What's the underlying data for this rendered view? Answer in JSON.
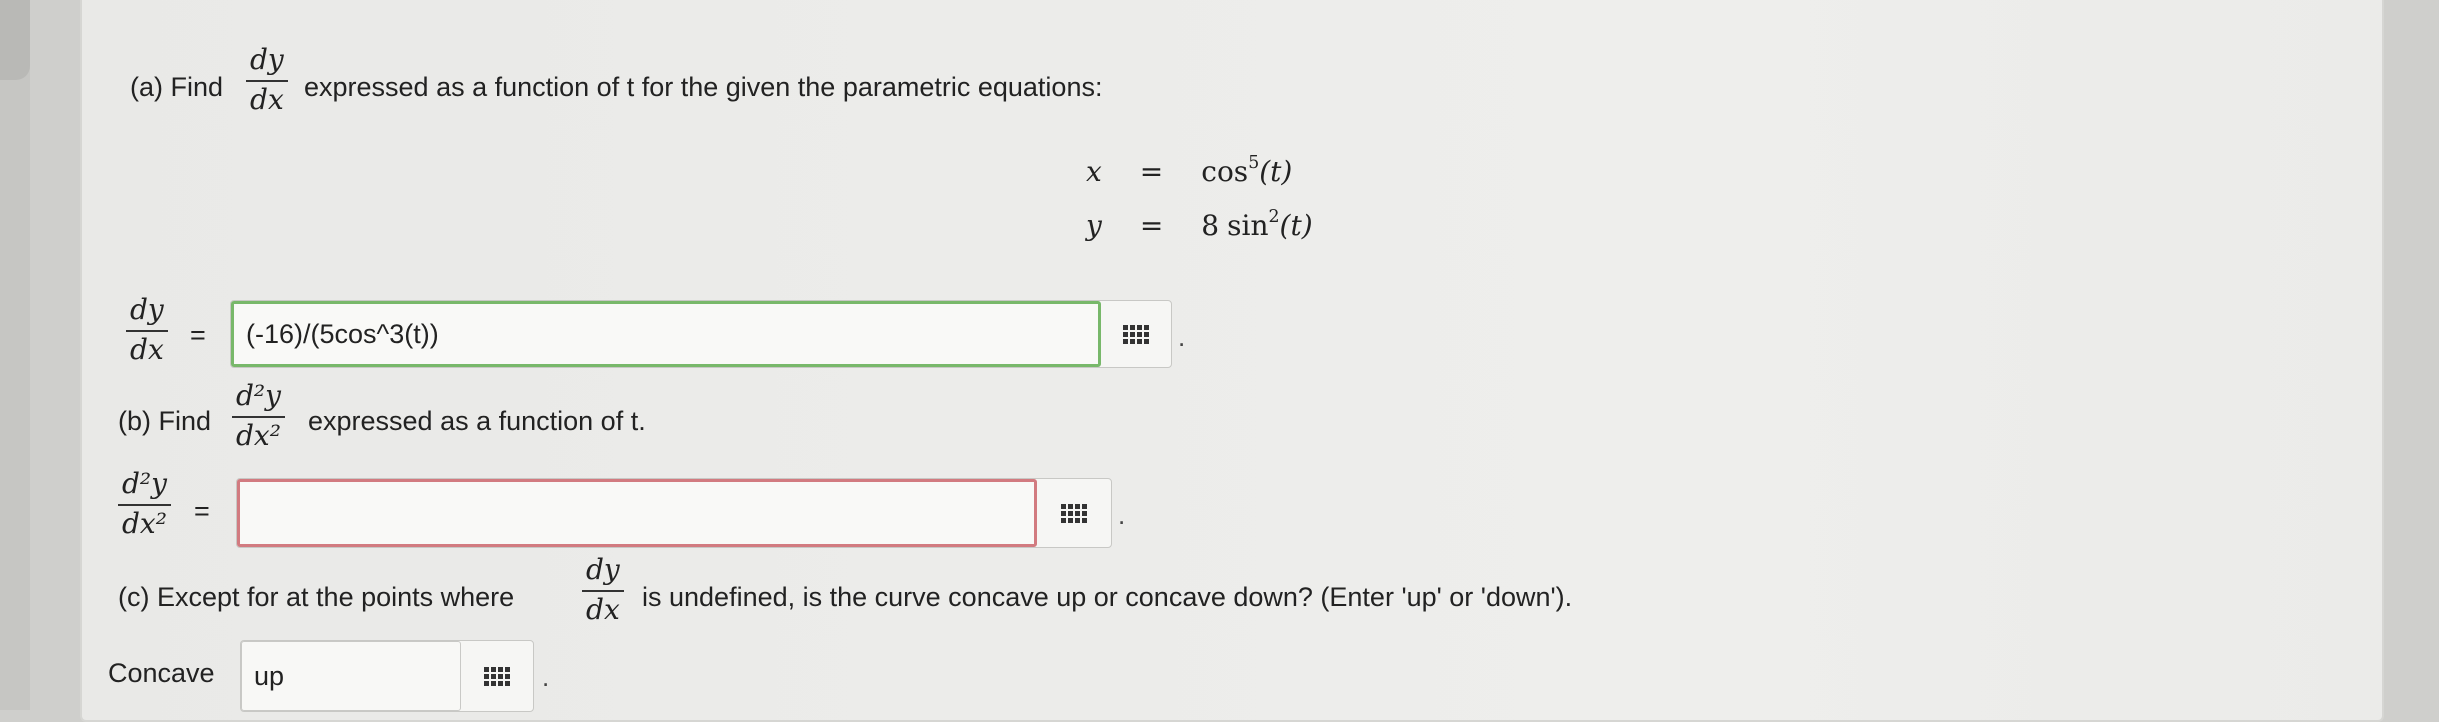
{
  "part_a": {
    "prefix": "(a) Find",
    "frac_num": "dy",
    "frac_den": "dx",
    "suffix": "expressed as a function of t for the given the parametric equations:",
    "eq1_lhs": "x",
    "eq1_eq": "=",
    "eq1_fn": "cos",
    "eq1_exp": "5",
    "eq1_arg": "(t)",
    "eq2_lhs": "y",
    "eq2_eq": "=",
    "eq2_coef": "8",
    "eq2_fn": "sin",
    "eq2_exp": "2",
    "eq2_arg": "(t)",
    "answer_label_num": "dy",
    "answer_label_den": "dx",
    "answer_equals": "=",
    "answer_value": "(-16)/(5cos^3(t))",
    "period": "."
  },
  "part_b": {
    "prefix": "(b) Find",
    "frac_num": "d²y",
    "frac_den": "dx²",
    "suffix": "expressed as a function of t.",
    "answer_label_num": "d²y",
    "answer_label_den": "dx²",
    "answer_equals": "=",
    "answer_value": "",
    "period": "."
  },
  "part_c": {
    "prefix": "(c) Except for at the points where",
    "frac_num": "dy",
    "frac_den": "dx",
    "suffix": "is undefined, is the curve concave up or concave down? (Enter 'up' or 'down').",
    "answer_label": "Concave",
    "answer_value": "up",
    "period": "."
  },
  "icons": [
    "grid-keyboard-icon"
  ],
  "colors": {
    "correct_border": "#78b86a",
    "incorrect_border": "#d27b80"
  }
}
